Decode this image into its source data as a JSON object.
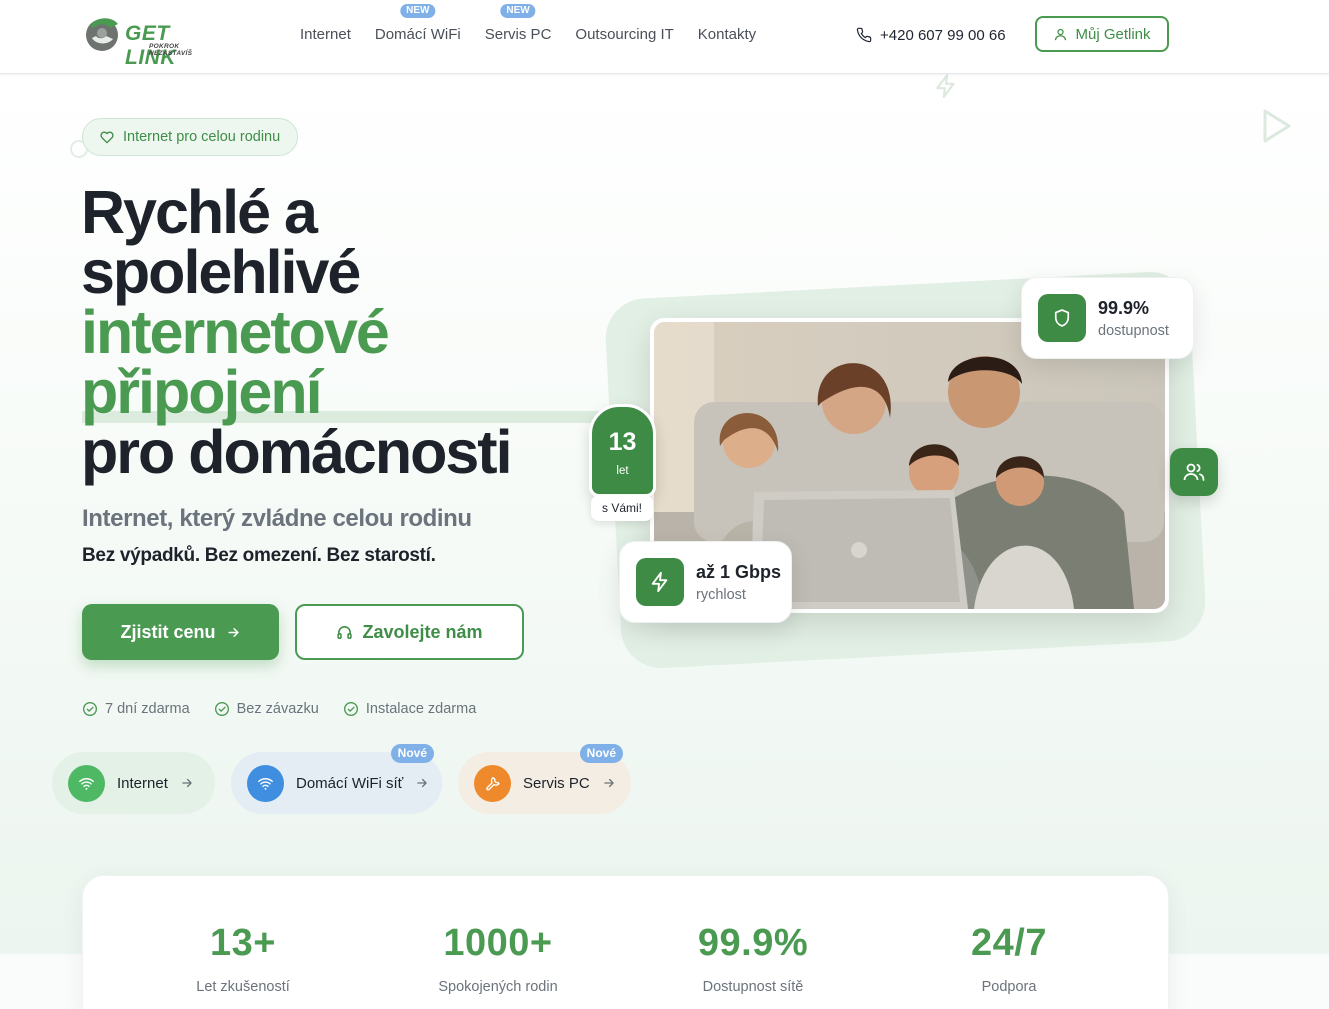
{
  "brand": {
    "name": "GET LINK",
    "tagline": "POKROK NEZASTAVÍŠ",
    "accent": "#4b9a52",
    "badge_color": "#7fb0e8"
  },
  "nav": {
    "items": [
      {
        "label": "Internet",
        "badge": ""
      },
      {
        "label": "Domácí WiFi",
        "badge": "NEW"
      },
      {
        "label": "Servis PC",
        "badge": "NEW"
      },
      {
        "label": "Outsourcing IT",
        "badge": ""
      },
      {
        "label": "Kontakty",
        "badge": ""
      }
    ],
    "phone": "+420 607 99 00 66",
    "phone_icon": "phone-icon",
    "account_label": "Můj Getlink",
    "account_icon": "user-icon"
  },
  "hero": {
    "pill": "Internet pro celou rodinu",
    "pill_icon": "heart-icon",
    "headline": {
      "line1": "Rychlé a",
      "line2": "spolehlivé",
      "line3": "internetové",
      "line4": "připojení",
      "line5": "pro domácnosti"
    },
    "subtitle": "Internet, který zvládne celou rodinu",
    "tagline": "Bez výpadků. Bez omezení. Bez starostí.",
    "cta_primary": "Zjistit cenu",
    "cta_secondary": "Zavolejte nám",
    "checks": [
      "7 dní zdarma",
      "Bez závazku",
      "Instalace zdarma"
    ]
  },
  "services": [
    {
      "label": "Internet",
      "icon": "wifi-icon",
      "badge": "",
      "color": "#4fb865"
    },
    {
      "label": "Domácí WiFi síť",
      "icon": "wifi-icon",
      "badge": "Nové",
      "color": "#3f8ee0"
    },
    {
      "label": "Servis PC",
      "icon": "wrench-icon",
      "badge": "Nové",
      "color": "#ef8a2c"
    }
  ],
  "image_badges": {
    "years_value": "13",
    "years_unit": "let",
    "years_caption": "s Vámi!",
    "uptime_value": "99.9%",
    "uptime_label": "dostupnost",
    "speed_value": "až 1 Gbps",
    "speed_label": "rychlost"
  },
  "stats": [
    {
      "value": "13+",
      "label": "Let zkušeností"
    },
    {
      "value": "1000+",
      "label": "Spokojených rodin"
    },
    {
      "value": "99.9%",
      "label": "Dostupnost sítě"
    },
    {
      "value": "24/7",
      "label": "Podpora"
    }
  ]
}
